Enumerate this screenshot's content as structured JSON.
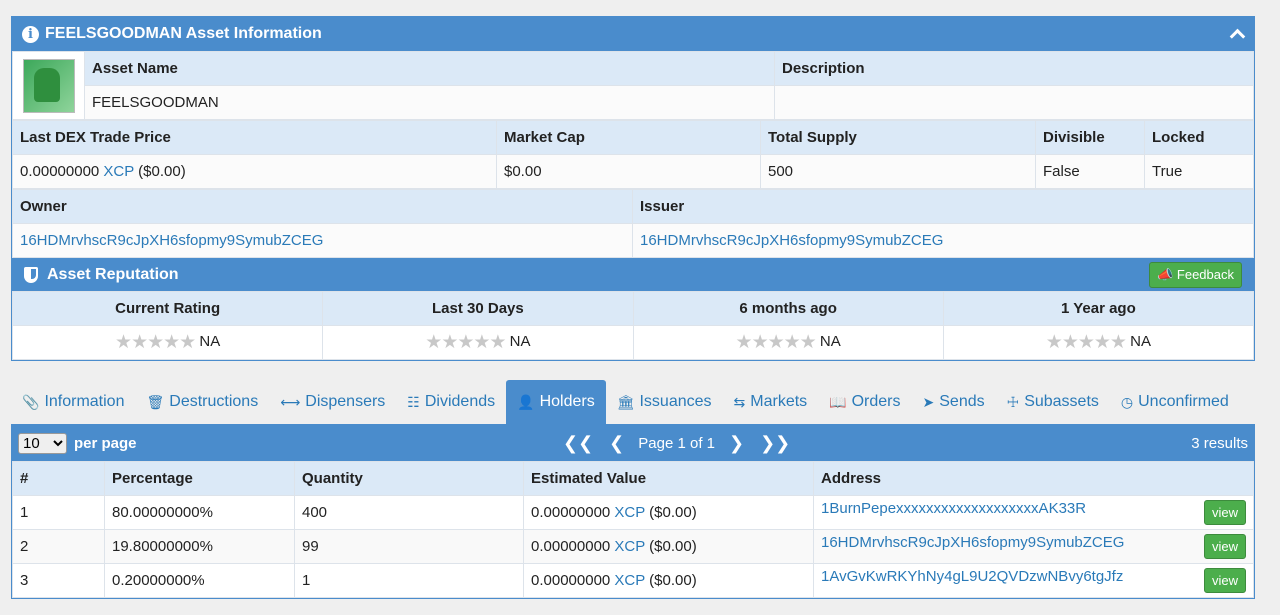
{
  "asset_panel": {
    "title": "FEELSGOODMAN Asset Information",
    "asset_name_header": "Asset Name",
    "description_header": "Description",
    "asset_name": "FEELSGOODMAN",
    "description": "",
    "trade_price_header": "Last DEX Trade Price",
    "market_cap_header": "Market Cap",
    "total_supply_header": "Total Supply",
    "divisible_header": "Divisible",
    "locked_header": "Locked",
    "trade_price_value": "0.00000000",
    "trade_price_unit": "XCP",
    "trade_price_usd": "($0.00)",
    "market_cap": "$0.00",
    "total_supply": "500",
    "divisible": "False",
    "locked": "True",
    "owner_header": "Owner",
    "issuer_header": "Issuer",
    "owner": "16HDMrvhscR9cJpXH6sfopmy9SymubZCEG",
    "issuer": "16HDMrvhscR9cJpXH6sfopmy9SymubZCEG"
  },
  "reputation": {
    "title": "Asset Reputation",
    "feedback_label": "Feedback",
    "columns": [
      "Current Rating",
      "Last 30 Days",
      "6 months ago",
      "1 Year ago"
    ],
    "ratings": [
      "NA",
      "NA",
      "NA",
      "NA"
    ]
  },
  "tabs": [
    {
      "label": "Information",
      "icon": "paperclip-icon"
    },
    {
      "label": "Destructions",
      "icon": "trash-icon"
    },
    {
      "label": "Dispensers",
      "icon": "arrows-horizontal-icon"
    },
    {
      "label": "Dividends",
      "icon": "sitemap-icon"
    },
    {
      "label": "Holders",
      "icon": "user-icon",
      "active": true
    },
    {
      "label": "Issuances",
      "icon": "bank-icon"
    },
    {
      "label": "Markets",
      "icon": "exchange-icon"
    },
    {
      "label": "Orders",
      "icon": "book-icon"
    },
    {
      "label": "Sends",
      "icon": "paper-plane-icon"
    },
    {
      "label": "Subassets",
      "icon": "child-icon"
    },
    {
      "label": "Unconfirmed",
      "icon": "clock-icon"
    }
  ],
  "holders": {
    "per_page_value": "10",
    "per_page_label": "per page",
    "page_label": "Page 1 of 1",
    "results": "3 results",
    "headers": [
      "#",
      "Percentage",
      "Quantity",
      "Estimated Value",
      "Address"
    ],
    "view_label": "view",
    "unit": "XCP",
    "rows": [
      {
        "n": "1",
        "pct": "80.00000000%",
        "qty": "400",
        "value": "0.00000000",
        "usd": "($0.00)",
        "address": "1BurnPepexxxxxxxxxxxxxxxxxxxAK33R"
      },
      {
        "n": "2",
        "pct": "19.80000000%",
        "qty": "99",
        "value": "0.00000000",
        "usd": "($0.00)",
        "address": "16HDMrvhscR9cJpXH6sfopmy9SymubZCEG"
      },
      {
        "n": "3",
        "pct": "0.20000000%",
        "qty": "1",
        "value": "0.00000000",
        "usd": "($0.00)",
        "address": "1AvGvKwRKYhNy4gL9U2QVDzwNBvy6tgJfz"
      }
    ]
  }
}
